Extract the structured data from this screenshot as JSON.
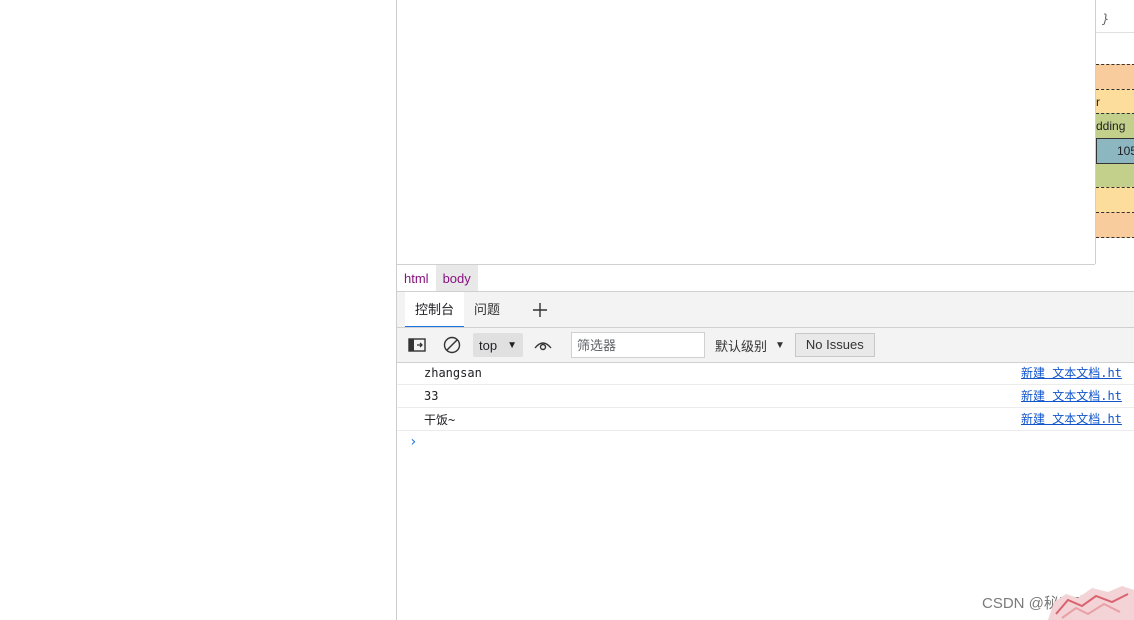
{
  "devtools": {
    "styles_sidebar": {
      "closing_brace": "}",
      "box_model": {
        "border_label": "r",
        "padding_label": "dding",
        "content_size": "105"
      }
    },
    "breadcrumb": {
      "items": [
        "html",
        "body"
      ],
      "active": "body"
    },
    "drawer_tabs": {
      "console": "控制台",
      "issues": "问题",
      "add_icon": "plus-icon"
    },
    "console_toolbar": {
      "sidebar_icon": "sidebar-toggle-icon",
      "clear_icon": "clear-console-icon",
      "context": "top",
      "eye_icon": "live-expression-icon",
      "filter_placeholder": "筛选器",
      "levels": "默认级别",
      "issues_button": "No Issues"
    },
    "messages": [
      {
        "text": "zhangsan",
        "source": "新建 文本文档.ht"
      },
      {
        "text": "33",
        "source": "新建 文本文档.ht"
      },
      {
        "text": "干饭~",
        "source": "新建 文本文档.ht"
      }
    ],
    "prompt": "›"
  },
  "watermark": "CSDN @秘客李华",
  "colors": {
    "accent": "#1a73e8",
    "margin": "#f9cc9d",
    "border": "#fddd9b",
    "padding": "#c3d08b",
    "content": "#8cb6c0",
    "tag": "#881280",
    "link": "#1155cc"
  }
}
